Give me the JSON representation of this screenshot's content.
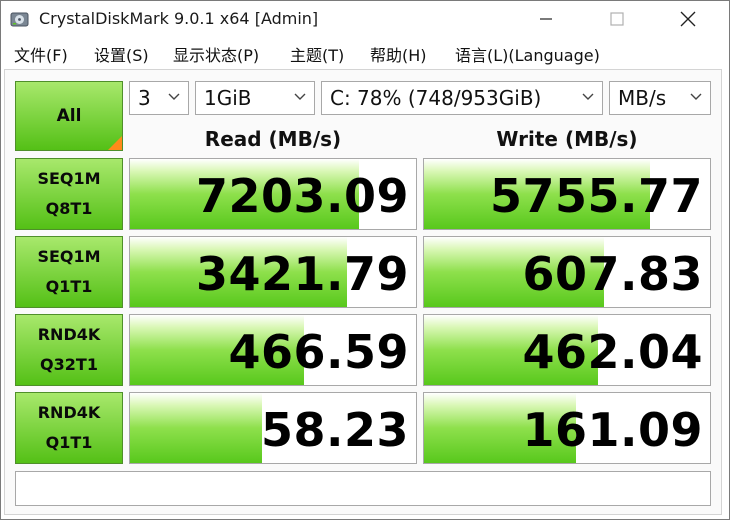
{
  "window": {
    "title": "CrystalDiskMark 9.0.1 x64 [Admin]"
  },
  "menu": {
    "items": [
      "文件(F)",
      "设置(S)",
      "显示状态(P)",
      "主题(T)",
      "帮助(H)",
      "语言(L)(Language)"
    ]
  },
  "controls": {
    "all_label": "All",
    "count": "3",
    "size": "1GiB",
    "drive": "C: 78% (748/953GiB)",
    "unit": "MB/s"
  },
  "headers": {
    "read": "Read (MB/s)",
    "write": "Write (MB/s)"
  },
  "tests": [
    {
      "line1": "SEQ1M",
      "line2": "Q8T1",
      "read": "7203.09",
      "write": "5755.77",
      "read_fill": 0.8,
      "write_fill": 0.79
    },
    {
      "line1": "SEQ1M",
      "line2": "Q1T1",
      "read": "3421.79",
      "write": "607.83",
      "read_fill": 0.76,
      "write_fill": 0.63
    },
    {
      "line1": "RND4K",
      "line2": "Q32T1",
      "read": "466.59",
      "write": "462.04",
      "read_fill": 0.61,
      "write_fill": 0.61
    },
    {
      "line1": "RND4K",
      "line2": "Q1T1",
      "read": "58.23",
      "write": "161.09",
      "read_fill": 0.46,
      "write_fill": 0.53
    }
  ],
  "status_text": "",
  "colors": {
    "button_green": "#54c016",
    "bar_green": "#58c81c",
    "corner_orange": "#ff8a1a"
  },
  "icons": {
    "app": "crystaldiskmark-disk-icon",
    "minimize": "minimize-icon",
    "maximize": "maximize-icon",
    "close": "close-icon"
  }
}
